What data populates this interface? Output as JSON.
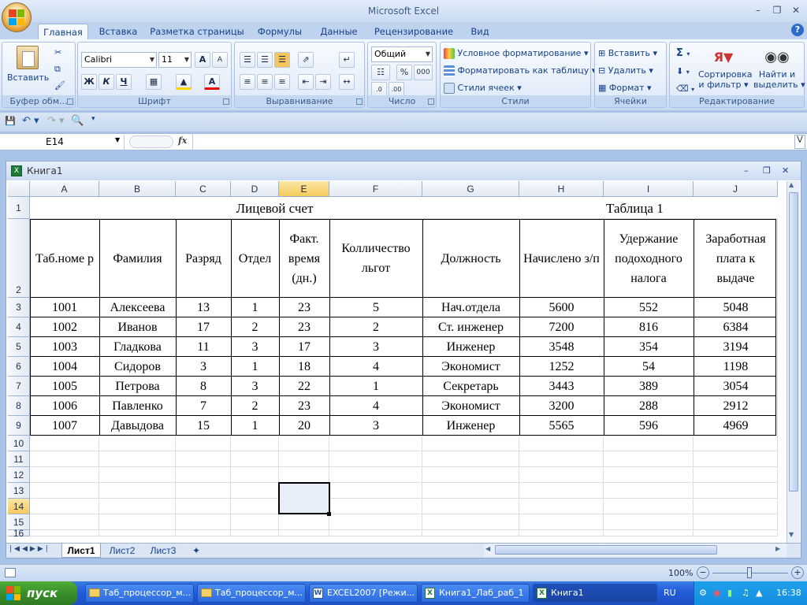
{
  "app": {
    "title": "Microsoft Excel"
  },
  "ribbon_tabs": [
    "Главная",
    "Вставка",
    "Разметка страницы",
    "Формулы",
    "Данные",
    "Рецензирование",
    "Вид"
  ],
  "ribbon": {
    "clipboard": {
      "paste_label": "Вставить",
      "group_label": "Буфер обм..."
    },
    "font": {
      "name": "Calibri",
      "size": "11",
      "bold": "Ж",
      "italic": "К",
      "underline": "Ч",
      "grow": "A",
      "shrink": "A",
      "color_label": "A",
      "group_label": "Шрифт"
    },
    "alignment": {
      "group_label": "Выравнивание"
    },
    "number": {
      "format": "Общий",
      "percent": "%",
      "thousands": "000",
      "group_label": "Число"
    },
    "styles": {
      "conditional": "Условное форматирование",
      "as_table": "Форматировать как таблицу",
      "cell_styles": "Стили ячеек",
      "group_label": "Стили"
    },
    "cells": {
      "insert": "Вставить",
      "delete": "Удалить",
      "format": "Формат",
      "group_label": "Ячейки"
    },
    "editing": {
      "sum": "Σ",
      "sort_line1": "Сортировка",
      "sort_line2": "и фильтр",
      "find_line1": "Найти и",
      "find_line2": "выделить",
      "group_label": "Редактирование"
    }
  },
  "formula_bar": {
    "name_box": "E14",
    "fx": "fx",
    "formula": ""
  },
  "workbook": {
    "title": "Книга1",
    "columns": [
      "A",
      "B",
      "C",
      "D",
      "E",
      "F",
      "G",
      "H",
      "I",
      "J"
    ],
    "rows": [
      "1",
      "2",
      "3",
      "4",
      "5",
      "6",
      "7",
      "8",
      "9",
      "10",
      "11",
      "12",
      "13",
      "14",
      "15",
      "16"
    ],
    "selected_cell": "E14",
    "row1": {
      "title": "Лицевой счет",
      "table_label": "Таблица 1"
    },
    "headers": [
      "Таб.номе р",
      "Фамилия",
      "Разряд",
      "Отдел",
      "Факт. время (дн.)",
      "Колличество льгот",
      "Должность",
      "Начислено з/п",
      "Удержание подоходного налога",
      "Заработная плата к выдаче"
    ],
    "data": [
      [
        "1001",
        "Алексеева",
        "13",
        "1",
        "23",
        "5",
        "Нач.отдела",
        "5600",
        "552",
        "5048"
      ],
      [
        "1002",
        "Иванов",
        "17",
        "2",
        "23",
        "2",
        "Ст. инженер",
        "7200",
        "816",
        "6384"
      ],
      [
        "1003",
        "Гладкова",
        "11",
        "3",
        "17",
        "3",
        "Инженер",
        "3548",
        "354",
        "3194"
      ],
      [
        "1004",
        "Сидоров",
        "3",
        "1",
        "18",
        "4",
        "Экономист",
        "1252",
        "54",
        "1198"
      ],
      [
        "1005",
        "Петрова",
        "8",
        "3",
        "22",
        "1",
        "Секретарь",
        "3443",
        "389",
        "3054"
      ],
      [
        "1006",
        "Павленко",
        "7",
        "2",
        "23",
        "4",
        "Экономист",
        "3200",
        "288",
        "2912"
      ],
      [
        "1007",
        "Давыдова",
        "15",
        "1",
        "20",
        "3",
        "Инженер",
        "5565",
        "596",
        "4969"
      ]
    ],
    "sheets": [
      "Лист1",
      "Лист2",
      "Лист3"
    ],
    "active_sheet": "Лист1"
  },
  "status": {
    "zoom": "100%"
  },
  "taskbar": {
    "start": "пуск",
    "tasks": [
      "Таб_процессор_м...",
      "Таб_процессор_м...",
      "EXCEL2007 [Режи...",
      "Книга1_Лаб_раб_1",
      "Книга1"
    ],
    "lang": "RU",
    "clock": "16:38"
  }
}
